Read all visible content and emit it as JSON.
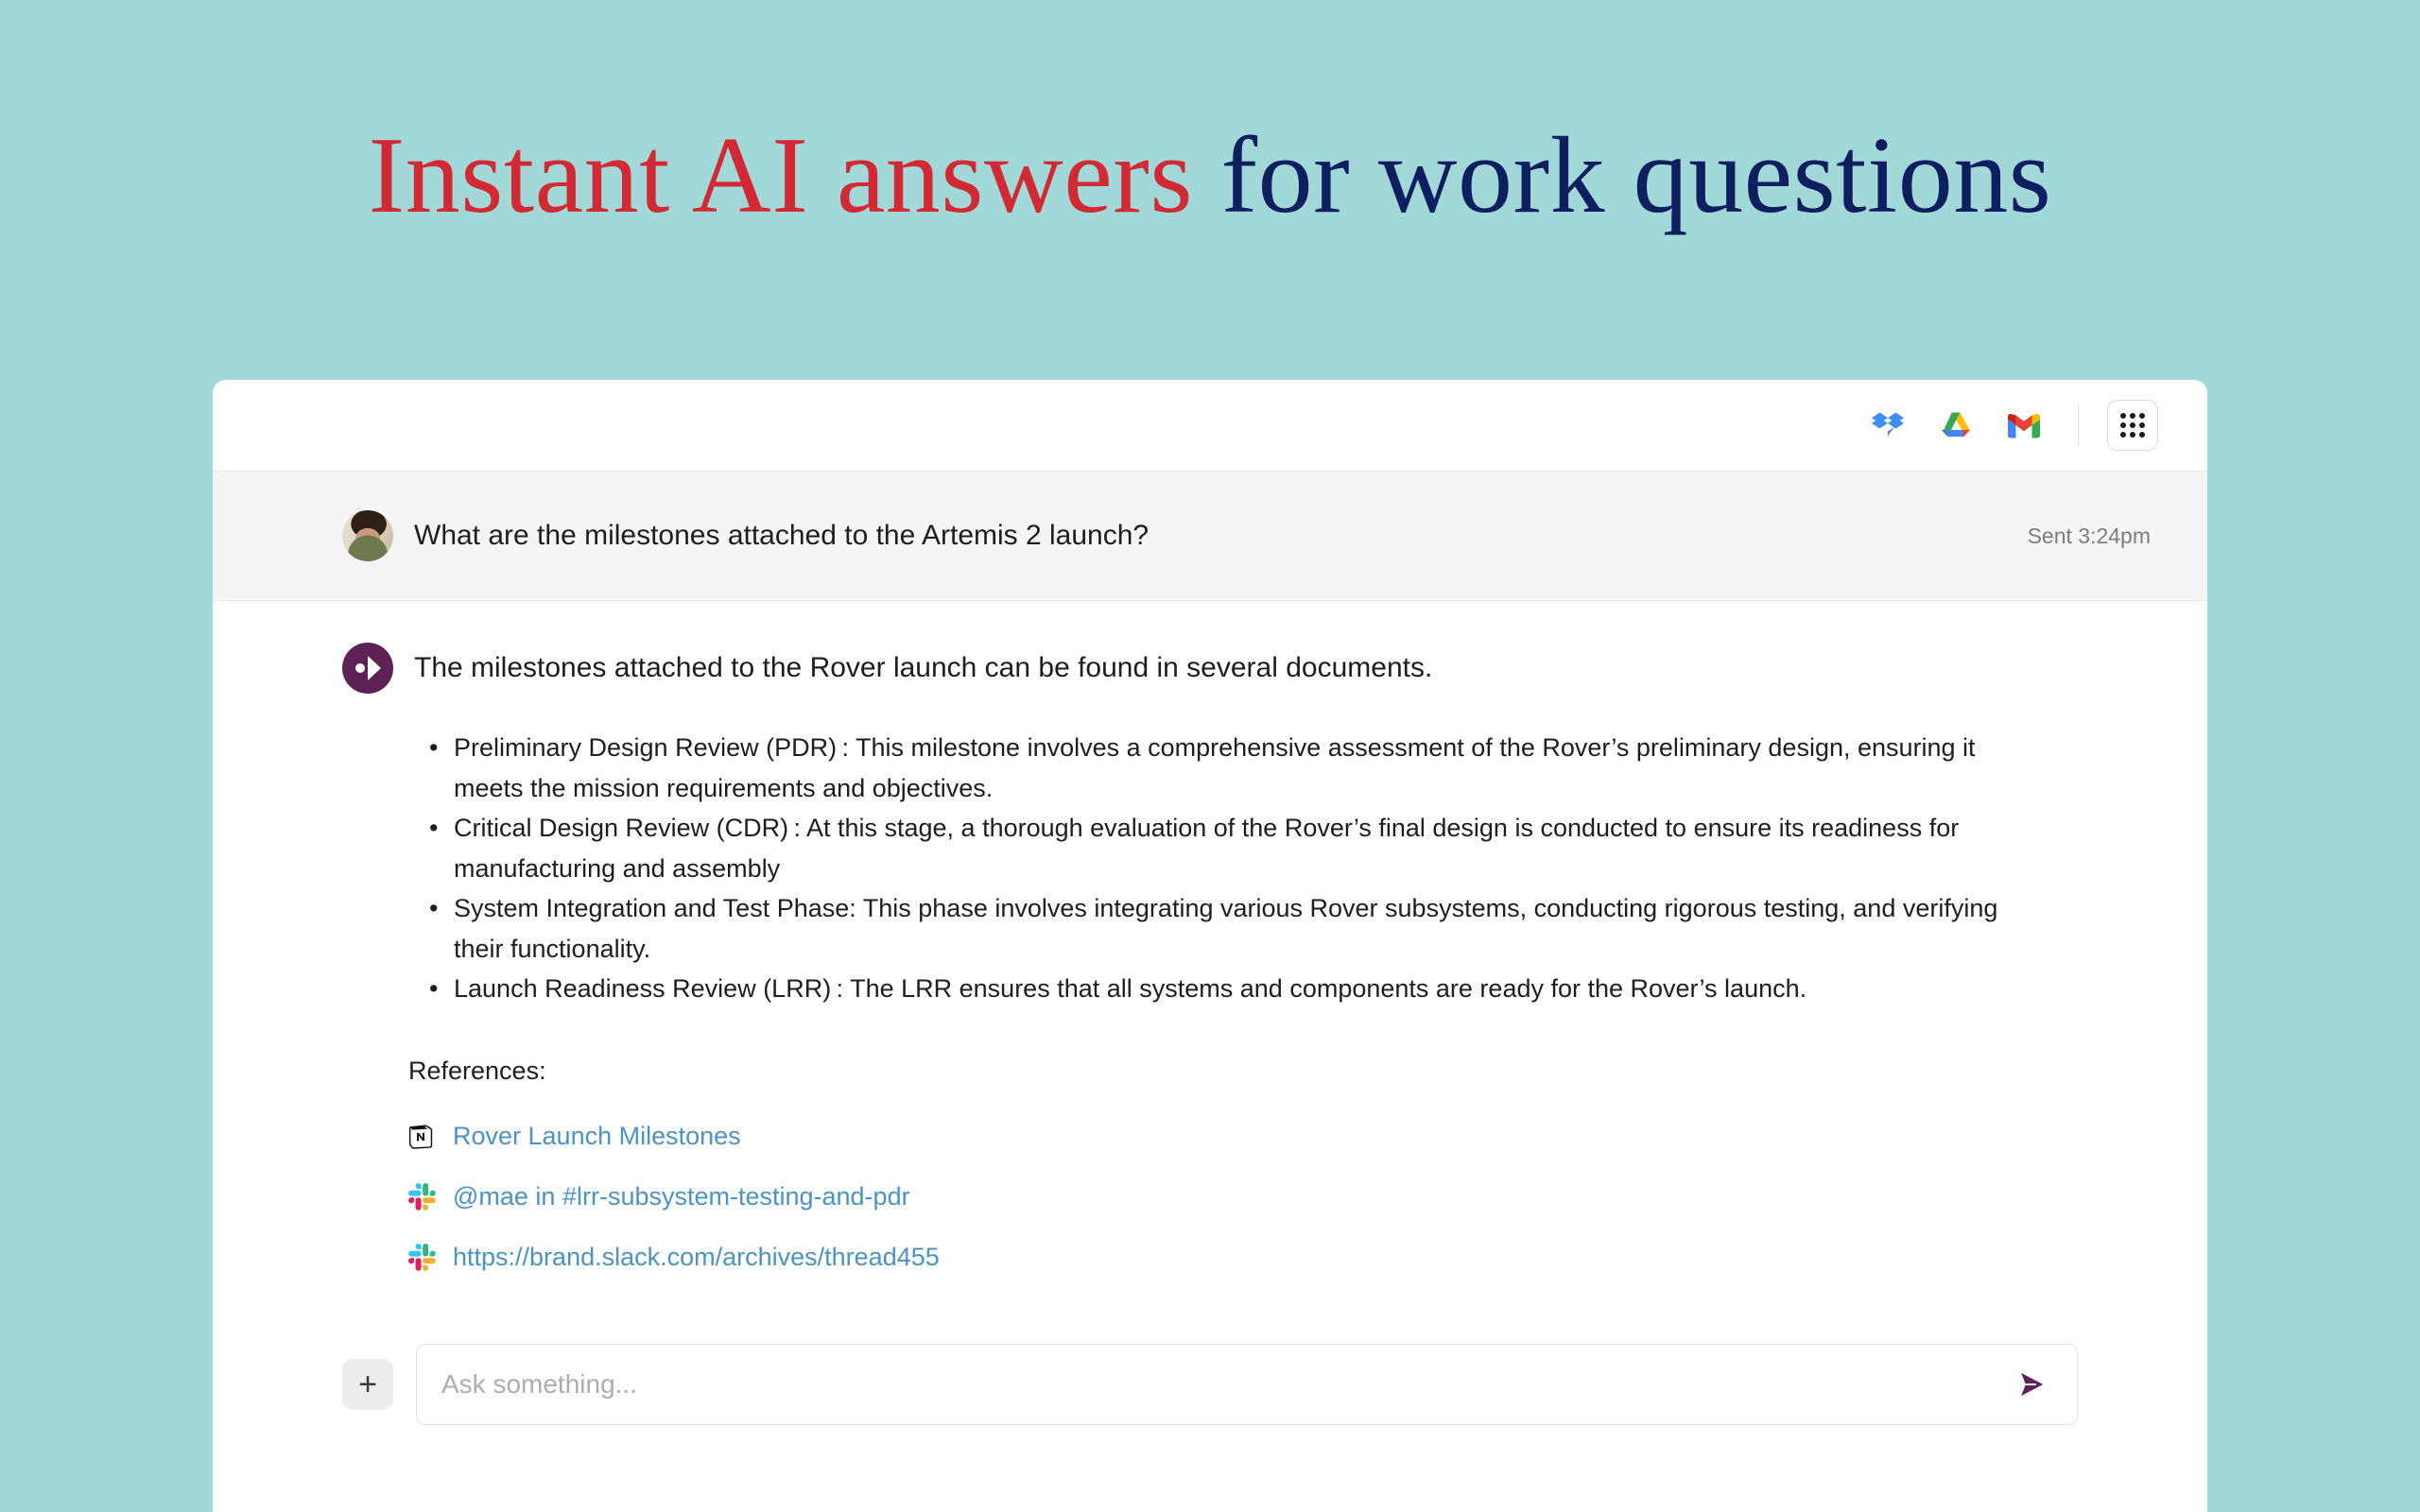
{
  "hero": {
    "headline_part1": "Instant AI answers ",
    "headline_part2": "for work questions",
    "color_red": "#d12a35",
    "color_navy": "#0d1f5e",
    "background": "#a3d8d8"
  },
  "header": {
    "service_icons": [
      "dropbox-icon",
      "google-drive-icon",
      "gmail-icon"
    ],
    "apps_button": "apps-grid-button"
  },
  "question": {
    "text": "What are the milestones attached to the Artemis 2 launch?",
    "timestamp": "Sent 3:24pm",
    "avatar": "user-avatar"
  },
  "answer": {
    "intro": "The milestones attached to the Rover launch can be found in several documents.",
    "bullets": [
      "Preliminary Design Review (PDR) : This milestone involves a comprehensive assessment of the Rover’s preliminary design, ensuring it meets the mission requirements and objectives.",
      "Critical Design Review (CDR) : At this stage, a thorough evaluation of the Rover’s final design is conducted to ensure its readiness for manufacturing and assembly",
      "System Integration and Test Phase: This phase involves integrating various Rover subsystems, conducting rigorous testing, and verifying their functionality.",
      "Launch Readiness Review (LRR) : The LRR ensures that all systems and components are ready for the Rover’s launch."
    ],
    "references_label": "References:",
    "references": [
      {
        "icon": "notion-icon",
        "label": "Rover Launch Milestones"
      },
      {
        "icon": "slack-icon",
        "label": "@mae in #lrr-subsystem-testing-and-pdr"
      },
      {
        "icon": "slack-icon",
        "label": "https://brand.slack.com/archives/thread455"
      }
    ],
    "bot_badge": "assistant-avatar",
    "accent_color": "#5d2156",
    "link_color": "#4a94c4"
  },
  "composer": {
    "add_label": "+",
    "placeholder": "Ask something...",
    "value": "",
    "send_icon": "send-icon"
  }
}
